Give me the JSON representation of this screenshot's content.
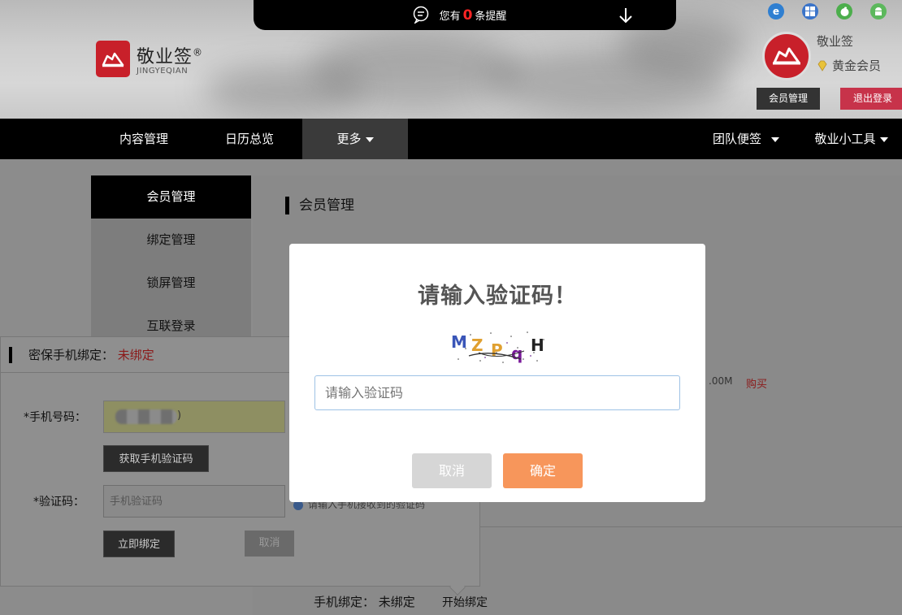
{
  "header": {
    "notice_prefix": "您有",
    "notice_count": "0",
    "notice_suffix": "条提醒",
    "logo_cn": "敬业签",
    "logo_reg": "®",
    "logo_en": "JINGYEQIAN",
    "user_name": "敬业签",
    "vip_label": "黄金会员",
    "member_btn": "会员管理",
    "logout_btn": "退出登录",
    "os_icons": [
      "ie-icon",
      "windows-icon",
      "apple-icon",
      "android-icon"
    ]
  },
  "nav": {
    "items": [
      "内容管理",
      "日历总览",
      "更多"
    ],
    "right": [
      "团队便签",
      "敬业小工具"
    ]
  },
  "sidebar": {
    "items": [
      "会员管理",
      "绑定管理",
      "锁屏管理",
      "互联登录"
    ]
  },
  "main": {
    "title": "会员管理",
    "ghost_size": ".00M",
    "ghost_buy": "购买",
    "bind_status_label": "手机绑定：",
    "bind_status_value": "未绑定",
    "bind_start": "开始绑定"
  },
  "bind_panel": {
    "title": "密保手机绑定：",
    "status": "未绑定",
    "phone_label": "*手机号码：",
    "phone_tail": ")",
    "get_code_btn": "获取手机验证码",
    "code_label": "*验证码：",
    "code_placeholder": "手机验证码",
    "bind_now_btn": "立即绑定",
    "cancel_btn": "取消",
    "hint": "请输入手机接收到的验证码"
  },
  "modal": {
    "title": "请输入验证码！",
    "captcha_text": "MZPqH",
    "input_placeholder": "请输入验证码",
    "cancel": "取消",
    "ok": "确定"
  },
  "colors": {
    "brand_red": "#c8202a",
    "ok_orange": "#f7965b",
    "logout_red": "#c7334a"
  }
}
